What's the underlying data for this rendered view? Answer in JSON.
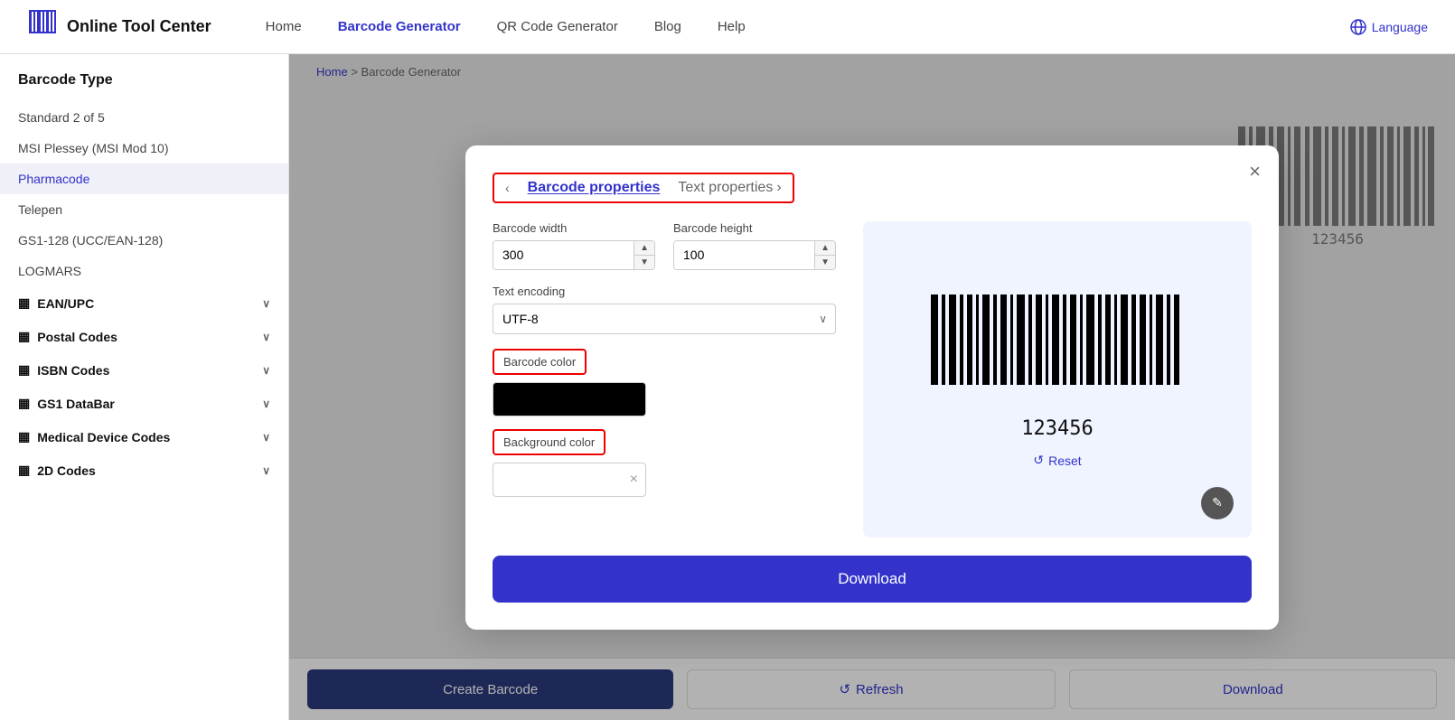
{
  "header": {
    "logo_text": "Online Tool Center",
    "nav_items": [
      {
        "label": "Home",
        "active": false
      },
      {
        "label": "Barcode Generator",
        "active": true
      },
      {
        "label": "QR Code Generator",
        "active": false
      },
      {
        "label": "Blog",
        "active": false
      },
      {
        "label": "Help",
        "active": false
      }
    ],
    "language_label": "Language"
  },
  "breadcrumb": {
    "home": "Home",
    "separator": ">",
    "current": "Barcode Generator"
  },
  "sidebar": {
    "title": "Barcode Type",
    "items": [
      {
        "label": "Standard 2 of 5",
        "active": false
      },
      {
        "label": "MSI Plessey (MSI Mod 10)",
        "active": false
      },
      {
        "label": "Pharmacode",
        "active": true
      },
      {
        "label": "Telepen",
        "active": false
      },
      {
        "label": "GS1-128 (UCC/EAN-128)",
        "active": false
      },
      {
        "label": "LOGMARS",
        "active": false
      }
    ],
    "groups": [
      {
        "label": "EAN/UPC",
        "icon": "▦"
      },
      {
        "label": "Postal Codes",
        "icon": "▦"
      },
      {
        "label": "ISBN Codes",
        "icon": "▦"
      },
      {
        "label": "GS1 DataBar",
        "icon": "▦"
      },
      {
        "label": "Medical Device Codes",
        "icon": "▦"
      },
      {
        "label": "2D Codes",
        "icon": "▦"
      }
    ]
  },
  "modal": {
    "tab_barcode_props": "Barcode properties",
    "tab_text_props": "Text properties",
    "close_label": "×",
    "barcode_width_label": "Barcode width",
    "barcode_width_value": "300",
    "barcode_height_label": "Barcode height",
    "barcode_height_value": "100",
    "text_encoding_label": "Text encoding",
    "text_encoding_value": "UTF-8",
    "barcode_color_label": "Barcode color",
    "background_color_label": "Background color",
    "barcode_number": "123456",
    "reset_label": "Reset",
    "download_label": "Download",
    "edit_icon": "✎"
  },
  "bottom_bar": {
    "create_label": "Create Barcode",
    "refresh_label": "Refresh",
    "download_label": "Download"
  }
}
